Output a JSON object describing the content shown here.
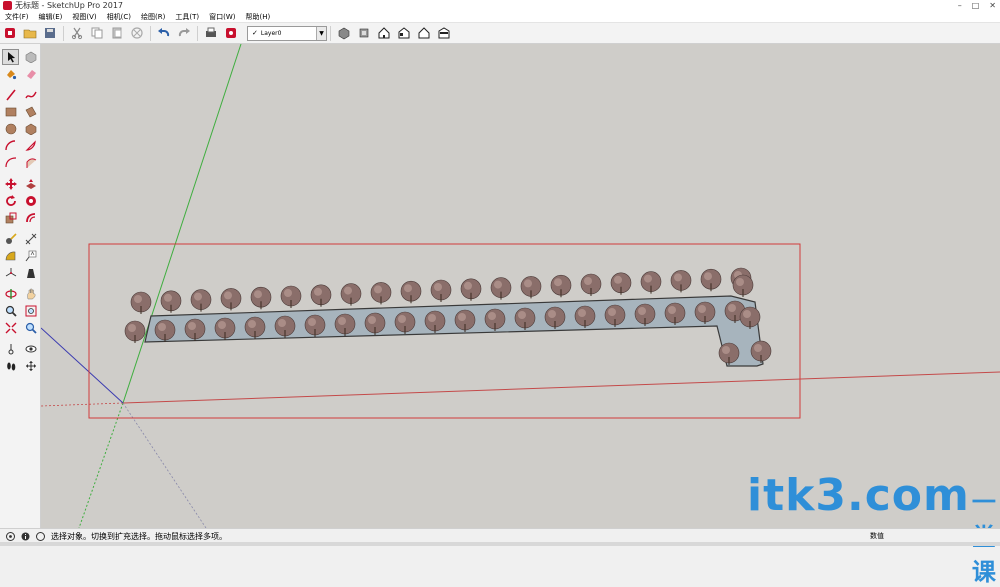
{
  "window": {
    "title": "无标题 - SketchUp Pro 2017",
    "controls": [
      "–",
      "□",
      "✕"
    ]
  },
  "menu": {
    "items": [
      "文件(F)",
      "编辑(E)",
      "视图(V)",
      "相机(C)",
      "绘图(R)",
      "工具(T)",
      "窗口(W)",
      "帮助(H)"
    ]
  },
  "toolbar": {
    "layer": {
      "check": "✓",
      "value": "Layer0"
    }
  },
  "status": {
    "text": "选择对象。切换到扩充选择。拖动鼠标选择多项。",
    "field": "数值"
  },
  "watermark": {
    "text": "itk3",
    "dot": ".com",
    "cn": "一堂课"
  },
  "scene": {
    "row_top_trees": 21,
    "row_bottom_trees": 21,
    "colors": {
      "viewport": "#cfcdc9",
      "path_fill": "#a7b4bd",
      "tree": "#8a6e6a",
      "green_axis": "#3fae3f",
      "red_axis": "#c44a4a",
      "blue_axis": "#3a3ab0",
      "selection_box": "#d23a3a"
    }
  },
  "icons": {
    "top": [
      "new-icon",
      "open-icon",
      "save-icon",
      "cut-icon",
      "copy-icon",
      "paste-icon",
      "erase-icon",
      "undo-icon",
      "redo-icon",
      "print-icon",
      "model-info-icon"
    ],
    "views": [
      "iso-view-icon",
      "top-view-icon",
      "front-view-icon",
      "right-view-icon",
      "back-view-icon",
      "left-view-icon"
    ],
    "left": [
      "select-icon",
      "component-icon",
      "paint-icon",
      "eraser-icon",
      "line-icon",
      "freehand-icon",
      "rectangle-icon",
      "rotated-rectangle-icon",
      "circle-icon",
      "polygon-icon",
      "arc-icon",
      "pie-icon",
      "two-point-arc-icon",
      "three-point-arc-icon",
      "move-icon",
      "push-pull-icon",
      "rotate-icon",
      "follow-me-icon",
      "scale-icon",
      "offset-icon",
      "tape-measure-icon",
      "dimension-icon",
      "protractor-icon",
      "text-icon",
      "axes-icon",
      "3d-text-icon",
      "orbit-icon",
      "pan-icon",
      "zoom-icon",
      "zoom-window-icon",
      "zoom-extents-icon",
      "previous-view-icon",
      "position-camera-icon",
      "look-around-icon",
      "walk-icon",
      "section-plane-icon"
    ]
  }
}
